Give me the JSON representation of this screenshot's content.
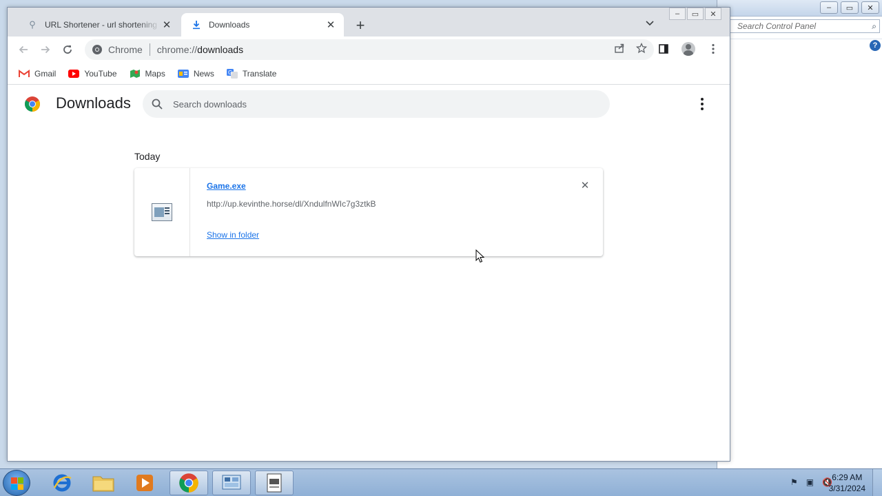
{
  "background_window": {
    "search_placeholder": "Search Control Panel",
    "help_glyph": "?"
  },
  "chrome": {
    "window_buttons": {
      "minimize": "–",
      "restore": "▭",
      "close": "✕"
    },
    "tabs": [
      {
        "title": "URL Shortener - url shortening service",
        "icon": "url-shortener-favicon",
        "active": false
      },
      {
        "title": "Downloads",
        "icon": "download-icon",
        "active": true
      }
    ],
    "new_tab_glyph": "+",
    "tab_search_glyph": "⌄",
    "omnibox": {
      "site_label": "Chrome",
      "url_scheme": "chrome://",
      "url_path": "downloads"
    },
    "bookmarks": [
      {
        "label": "Gmail",
        "icon": "gmail-icon",
        "glyph": "M",
        "color": "#ea4335"
      },
      {
        "label": "YouTube",
        "icon": "youtube-icon",
        "glyph": "▶",
        "color": "#ff0000"
      },
      {
        "label": "Maps",
        "icon": "maps-icon",
        "glyph": "◆",
        "color": "#34a853"
      },
      {
        "label": "News",
        "icon": "news-icon",
        "glyph": "▤",
        "color": "#4285f4"
      },
      {
        "label": "Translate",
        "icon": "translate-icon",
        "glyph": "G",
        "color": "#4285f4"
      }
    ]
  },
  "downloads": {
    "title": "Downloads",
    "search_placeholder": "Search downloads",
    "day_label": "Today",
    "items": [
      {
        "file_name": "Game.exe",
        "url": "http://up.kevinthe.horse/dl/XndulfnWIc7g3ztkB",
        "action_label": "Show in folder",
        "remove_glyph": "✕"
      }
    ]
  },
  "taskbar": {
    "items": [
      "internet-explorer",
      "file-explorer",
      "media-player",
      "chrome",
      "control-panel",
      "document"
    ],
    "clock_time": "6:29 AM",
    "clock_date": "3/31/2024"
  }
}
